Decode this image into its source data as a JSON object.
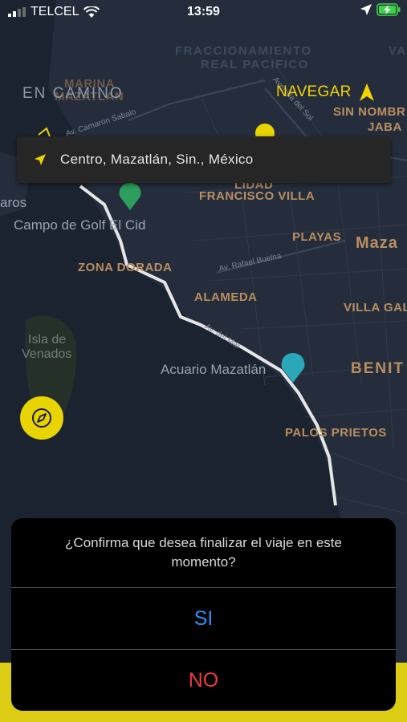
{
  "status_bar": {
    "carrier": "TELCEL",
    "time": "13:59"
  },
  "map": {
    "areas": {
      "fraccionamiento": "FRACCIONAMIENTO",
      "real_pacifico": "REAL PACIFICO",
      "marina": "MARINA",
      "mazatlan_label": "MAZATLAN",
      "sin_nombre": "SIN NOMBR",
      "jaba": "JABA",
      "va": "VA",
      "lidad": "LIDAD",
      "francisco_villa": "FRANCISCO VILLA",
      "playas": "PLAYAS",
      "mazatlan_city": "Maza",
      "zona_dorada": "ZONA DORADA",
      "alameda": "ALAMEDA",
      "villa_gal": "VILLA GAL",
      "benito": "BENIT",
      "palos_prietos": "PALOS PRIETOS"
    },
    "pois": {
      "campo_golf": "Campo de Golf El Cid",
      "isla_venados_1": "Isla de",
      "isla_venados_2": "Venados",
      "acuario": "Acuario Mazatlán",
      "aros": "aros"
    },
    "streets": {
      "camaron_sabalo": "Av. Camaron Sabalo",
      "rafael_buelna": "Av. Rafael Buelna",
      "del_sol": "Avenida del Sol",
      "del_mar": "Av. del Mar"
    },
    "overlay": {
      "en_camino": "EN CAMINO",
      "navegar": "NAVEGAR"
    }
  },
  "search": {
    "location": "Centro, Mazatlán, Sin., México"
  },
  "dialog": {
    "message": "¿Confirma que desea finalizar el viaje en este momento?",
    "yes_label": "SI",
    "no_label": "NO"
  },
  "colors": {
    "accent_yellow": "#e8d400",
    "yes_blue": "#2f8cf5",
    "no_red": "#ef3b3b",
    "map_bg": "#1f2735"
  }
}
